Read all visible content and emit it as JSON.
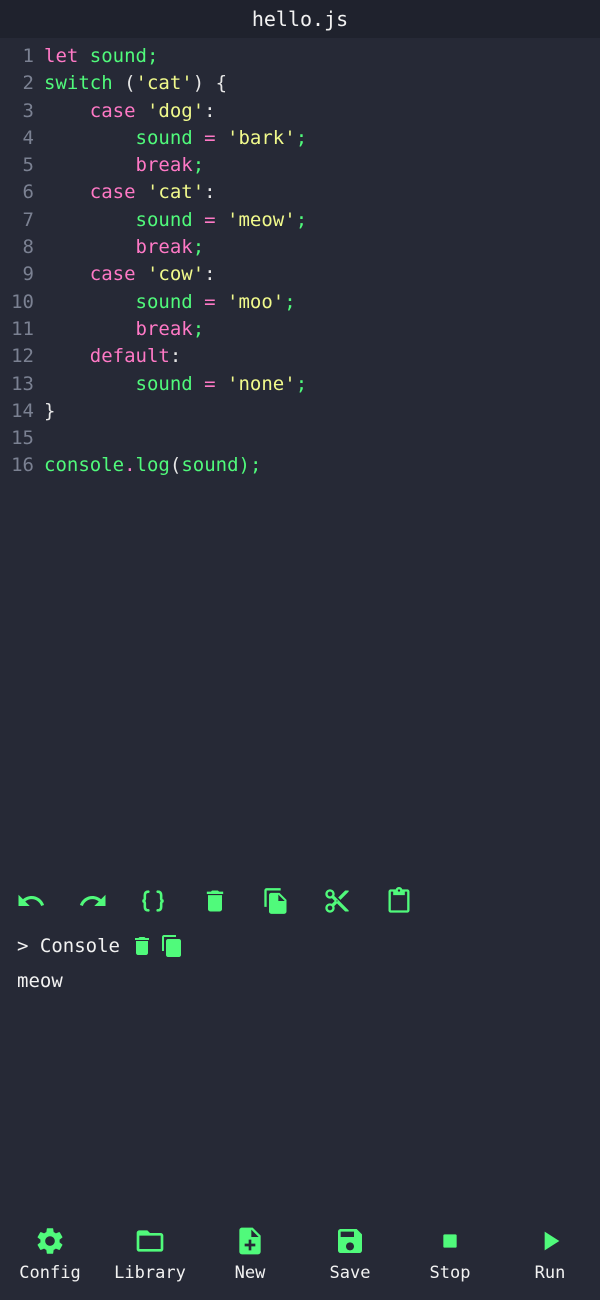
{
  "title": "hello.js",
  "editor": {
    "lines": [
      {
        "num": "1",
        "tokens": [
          {
            "t": "let ",
            "c": "kw"
          },
          {
            "t": "sound",
            "c": "id"
          },
          {
            "t": ";",
            "c": "id"
          }
        ]
      },
      {
        "num": "2",
        "tokens": [
          {
            "t": "switch",
            "c": "id"
          },
          {
            "t": " (",
            "c": "pl"
          },
          {
            "t": "'cat'",
            "c": "str"
          },
          {
            "t": ") {",
            "c": "pl"
          }
        ]
      },
      {
        "num": "3",
        "tokens": [
          {
            "t": "    case ",
            "c": "kw"
          },
          {
            "t": "'dog'",
            "c": "str"
          },
          {
            "t": ":",
            "c": "pl"
          }
        ]
      },
      {
        "num": "4",
        "tokens": [
          {
            "t": "        sound ",
            "c": "id"
          },
          {
            "t": "= ",
            "c": "kw"
          },
          {
            "t": "'bark'",
            "c": "str"
          },
          {
            "t": ";",
            "c": "id"
          }
        ]
      },
      {
        "num": "5",
        "tokens": [
          {
            "t": "        break",
            "c": "kw"
          },
          {
            "t": ";",
            "c": "id"
          }
        ]
      },
      {
        "num": "6",
        "tokens": [
          {
            "t": "    case ",
            "c": "kw"
          },
          {
            "t": "'cat'",
            "c": "str"
          },
          {
            "t": ":",
            "c": "pl"
          }
        ]
      },
      {
        "num": "7",
        "tokens": [
          {
            "t": "        sound ",
            "c": "id"
          },
          {
            "t": "= ",
            "c": "kw"
          },
          {
            "t": "'meow'",
            "c": "str"
          },
          {
            "t": ";",
            "c": "id"
          }
        ]
      },
      {
        "num": "8",
        "tokens": [
          {
            "t": "        break",
            "c": "kw"
          },
          {
            "t": ";",
            "c": "id"
          }
        ]
      },
      {
        "num": "9",
        "tokens": [
          {
            "t": "    case ",
            "c": "kw"
          },
          {
            "t": "'cow'",
            "c": "str"
          },
          {
            "t": ":",
            "c": "pl"
          }
        ]
      },
      {
        "num": "10",
        "tokens": [
          {
            "t": "        sound ",
            "c": "id"
          },
          {
            "t": "= ",
            "c": "kw"
          },
          {
            "t": "'moo'",
            "c": "str"
          },
          {
            "t": ";",
            "c": "id"
          }
        ]
      },
      {
        "num": "11",
        "tokens": [
          {
            "t": "        break",
            "c": "kw"
          },
          {
            "t": ";",
            "c": "id"
          }
        ]
      },
      {
        "num": "12",
        "tokens": [
          {
            "t": "    default",
            "c": "kw"
          },
          {
            "t": ":",
            "c": "pl"
          }
        ]
      },
      {
        "num": "13",
        "tokens": [
          {
            "t": "        sound ",
            "c": "id"
          },
          {
            "t": "= ",
            "c": "kw"
          },
          {
            "t": "'none'",
            "c": "str"
          },
          {
            "t": ";",
            "c": "id"
          }
        ]
      },
      {
        "num": "14",
        "tokens": [
          {
            "t": "}",
            "c": "pl"
          }
        ]
      },
      {
        "num": "15",
        "tokens": []
      },
      {
        "num": "16",
        "tokens": [
          {
            "t": "console",
            "c": "id"
          },
          {
            "t": ".",
            "c": "kw"
          },
          {
            "t": "log",
            "c": "id"
          },
          {
            "t": "(",
            "c": "pl"
          },
          {
            "t": "sound",
            "c": "id"
          },
          {
            "t": ");",
            "c": "id"
          }
        ]
      }
    ]
  },
  "toolbar": {
    "icons": [
      "undo-icon",
      "redo-icon",
      "braces-icon",
      "trash-icon",
      "copy-icon",
      "scissors-icon",
      "clipboard-icon"
    ]
  },
  "console": {
    "label": "> Console",
    "output": "meow"
  },
  "bottom_nav": {
    "items": [
      {
        "label": "Config",
        "icon": "gear-icon"
      },
      {
        "label": "Library",
        "icon": "folder-icon"
      },
      {
        "label": "New",
        "icon": "new-file-icon"
      },
      {
        "label": "Save",
        "icon": "floppy-icon"
      },
      {
        "label": "Stop",
        "icon": "stop-icon"
      },
      {
        "label": "Run",
        "icon": "play-icon"
      }
    ]
  },
  "colors": {
    "accent": "#50fa7b",
    "keyword": "#ff79c6",
    "string": "#f1fa8c",
    "background": "#262936",
    "titlebar": "#1f222d"
  }
}
